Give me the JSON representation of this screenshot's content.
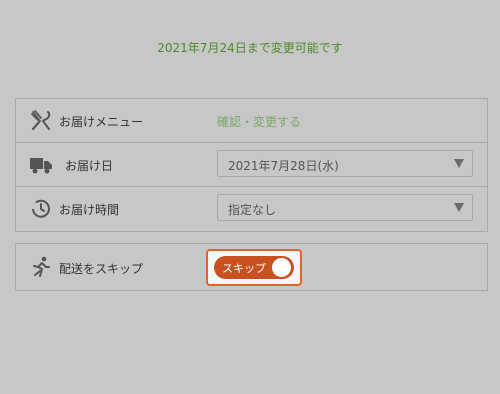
{
  "deadline_text": "2021年7月24日まで変更可能です",
  "menu": {
    "label": "お届けメニュー",
    "link": "確認・変更する"
  },
  "date": {
    "label": "お届け日",
    "value": "2021年7月28日(水)"
  },
  "time": {
    "label": "お届け時間",
    "value": "指定なし"
  },
  "skip": {
    "label": "配送をスキップ",
    "toggle_label": "スキップ",
    "toggle_on": true
  },
  "icons": {
    "menu": "fork-knife-icon",
    "date": "truck-icon",
    "time": "clock-icon",
    "skip": "running-person-icon"
  },
  "colors": {
    "accent": "#c9511f",
    "deadline": "#4f8a2a",
    "link": "#7aa86a"
  }
}
